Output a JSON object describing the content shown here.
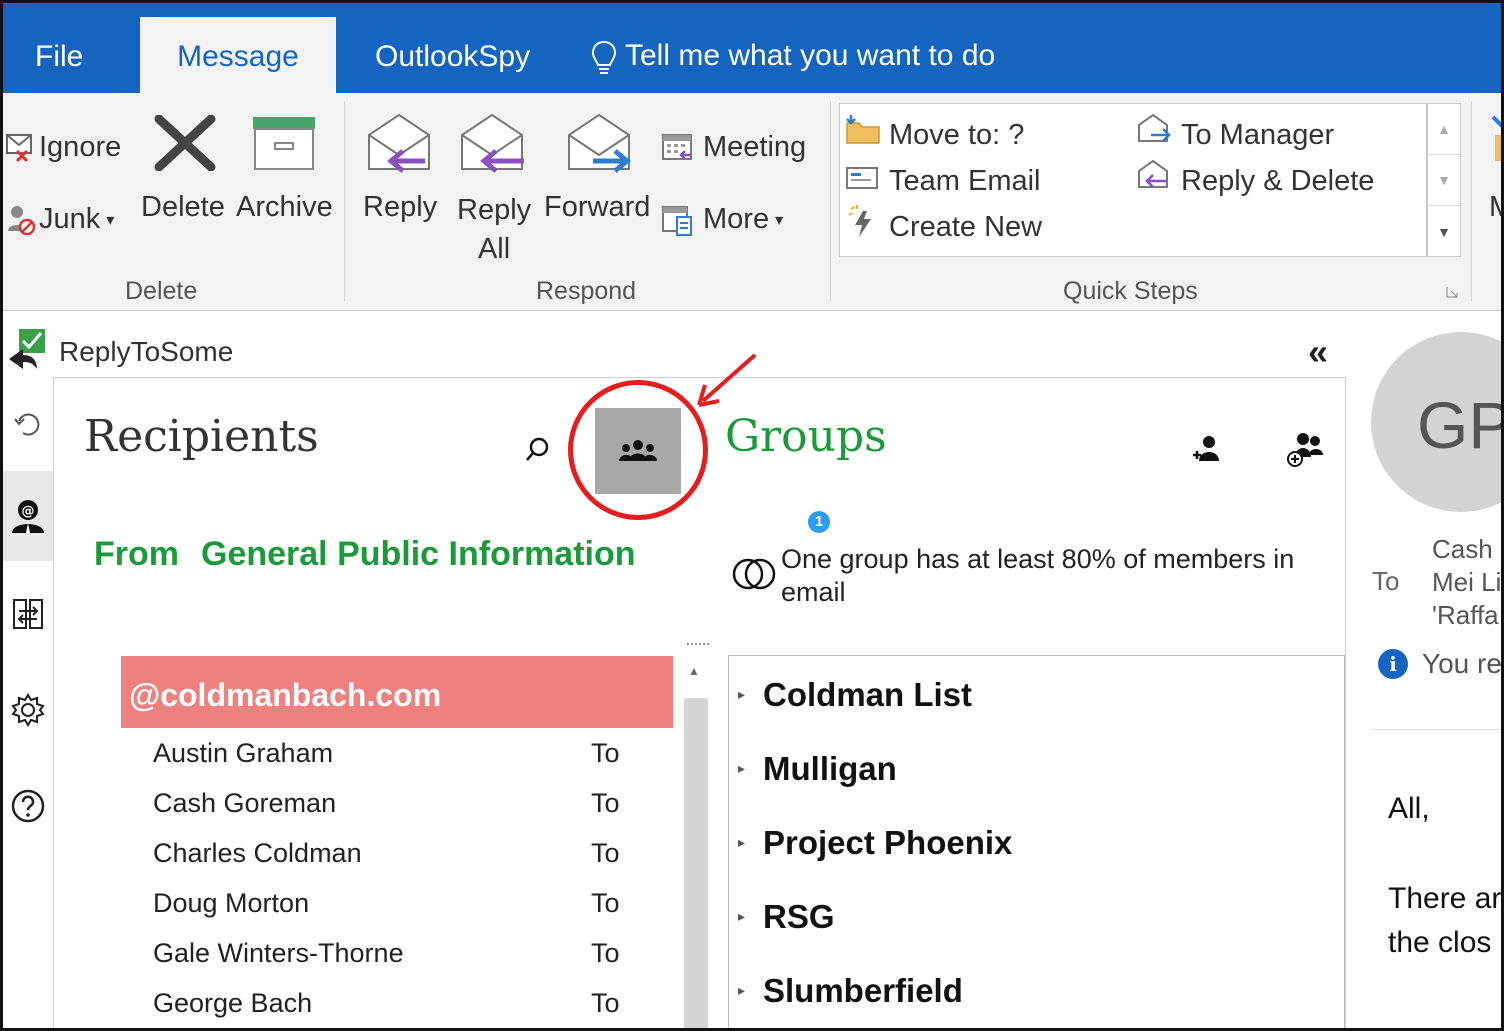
{
  "tabs": {
    "file": "File",
    "message": "Message",
    "outlookspy": "OutlookSpy",
    "tell_me": "Tell me what you want to do"
  },
  "ribbon": {
    "delete_group": {
      "title": "Delete",
      "ignore": "Ignore",
      "junk": "Junk",
      "delete": "Delete",
      "archive": "Archive"
    },
    "respond_group": {
      "title": "Respond",
      "reply": "Reply",
      "reply_all_line1": "Reply",
      "reply_all_line2": "All",
      "forward": "Forward",
      "meeting": "Meeting",
      "more": "More"
    },
    "quick_steps": {
      "title": "Quick Steps",
      "move_to": "Move to: ?",
      "team_email": "Team Email",
      "create_new": "Create New",
      "to_manager": "To Manager",
      "reply_delete": "Reply & Delete"
    },
    "next_label": "M"
  },
  "addin": {
    "title": "ReplyToSome",
    "collapse_icon": "double-chevron-left",
    "recipients_title": "Recipients",
    "groups_title": "Groups",
    "from_label": "From",
    "from_value": "General Public Information",
    "info_count": "1",
    "info_text": "One group has at least 80% of members in email",
    "domain": "@coldmanbach.com",
    "recipients": [
      {
        "name": "Austin Graham",
        "type": "To"
      },
      {
        "name": "Cash Goreman",
        "type": "To"
      },
      {
        "name": "Charles Coldman",
        "type": "To"
      },
      {
        "name": "Doug Morton",
        "type": "To"
      },
      {
        "name": "Gale Winters-Thorne",
        "type": "To"
      },
      {
        "name": "George Bach",
        "type": "To"
      }
    ],
    "groups": [
      "Coldman List",
      "Mulligan",
      "Project Phoenix",
      "RSG",
      "Slumberfield"
    ]
  },
  "reading_pane": {
    "avatar_initials": "GP",
    "to_label": "To",
    "to_line1": "Cash G",
    "to_line2": "Mei Li",
    "to_line3": "'Raffa",
    "notice": "You re",
    "body_line1": "All,",
    "body_line2": "There ar",
    "body_line3": "the clos"
  },
  "colors": {
    "ribbon_blue": "#1565c0",
    "green": "#1a9a3a",
    "domain_red": "#ef8080",
    "highlight_red": "#e41e1e"
  }
}
